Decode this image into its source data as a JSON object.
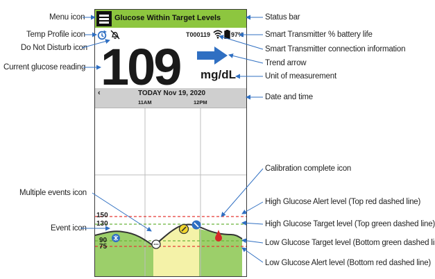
{
  "screen": {
    "status_bar_text": "Glucose Within Target Levels",
    "transmitter_id": "T000119",
    "battery_percent": "97%",
    "glucose_value": "109",
    "unit": "mg/dL",
    "date_label": "TODAY Nov 19, 2020",
    "time_ticks": [
      "11AM",
      "12PM"
    ],
    "y_labels": [
      "150",
      "130",
      "90",
      "75"
    ],
    "colors": {
      "status_green": "#8dc63f",
      "target_green": "#9ccf6a",
      "highlight_yellow": "#f4f2a8",
      "alert_red": "#e53935",
      "target_green_line": "#6bb43a",
      "trend_blue": "#2f6fc2"
    },
    "icons": [
      "menu-icon",
      "temp-profile-icon",
      "do-not-disturb-icon",
      "wifi-icon",
      "battery-icon",
      "trend-arrow-icon",
      "event-icon",
      "multiple-events-icon",
      "calibration-complete-icon"
    ]
  },
  "annotations": {
    "menu_icon": "Menu icon",
    "temp_profile_icon": "Temp Profile icon",
    "do_not_disturb_icon": "Do Not Disturb icon",
    "current_glucose": "Current glucose reading",
    "multiple_events": "Multiple events icon",
    "event_icon": "Event icon",
    "status_bar": "Status bar",
    "battery_life": "Smart Transmitter % battery life",
    "connection_info": "Smart Transmitter connection information",
    "trend_arrow": "Trend arrow",
    "unit_of_measurement": "Unit of measurement",
    "date_and_time": "Date and time",
    "calibration_complete": "Calibration complete icon",
    "high_alert": "High Glucose Alert level (Top red dashed line)",
    "high_target": "High Glucose Target level (Top green dashed line)",
    "low_target": "Low Glucose Target level (Bottom green dashed line)",
    "low_alert": "Low Glucose Alert level (Bottom red dashed line)"
  }
}
